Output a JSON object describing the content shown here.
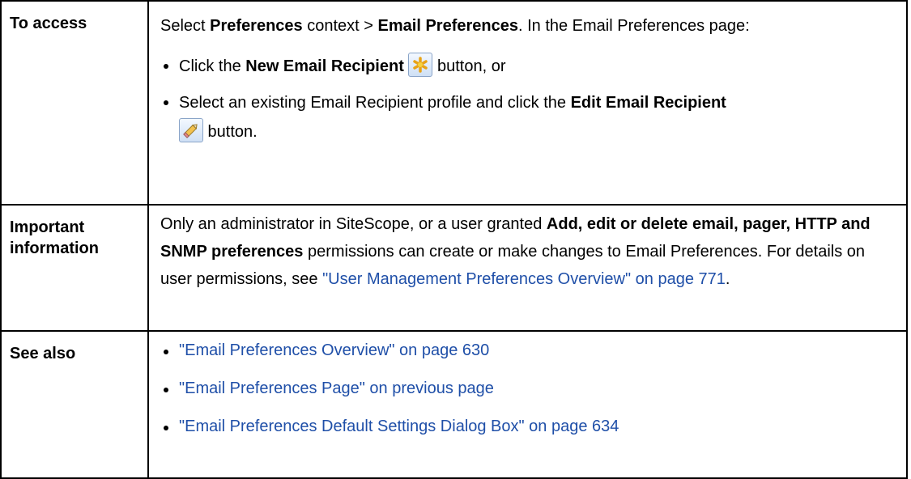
{
  "rows": {
    "access": {
      "label": "To access",
      "intro": {
        "t1": "Select ",
        "b1": "Preferences",
        "t2": " context > ",
        "b2": "Email Preferences",
        "t3": ". In the Email Preferences page:"
      },
      "bullet1": {
        "t1": "Click the ",
        "b1": "New Email Recipient",
        "icon": "new-recipient-icon",
        "t2": " button, or"
      },
      "bullet2": {
        "t1": "Select an existing Email Recipient profile and click the ",
        "b1": "Edit Email Recipient",
        "icon": "edit-pencil-icon",
        "t2": " button."
      }
    },
    "important": {
      "label": "Important information",
      "t1": "Only an administrator in SiteScope, or a user granted ",
      "b1": "Add, edit or delete email, pager, HTTP and SNMP preferences",
      "t2": " permissions can create or make changes to Email Preferences. For details on user permissions, see ",
      "link": "\"User Management Preferences Overview\" on page 771",
      "t3": "."
    },
    "see_also": {
      "label": "See also",
      "links": [
        "\"Email Preferences Overview\" on page 630",
        "\"Email Preferences Page\" on previous page",
        "\"Email Preferences Default Settings Dialog Box\" on page 634"
      ]
    }
  },
  "colors": {
    "link": "#1f4fa8",
    "border": "#000000"
  }
}
